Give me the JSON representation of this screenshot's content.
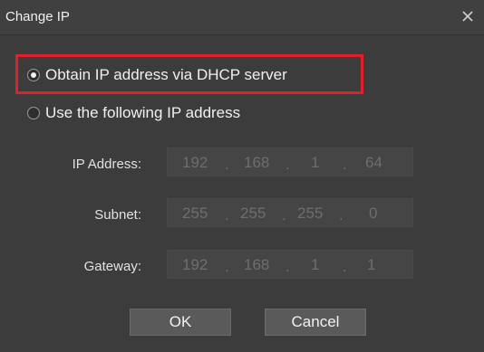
{
  "window": {
    "title": "Change IP"
  },
  "options": {
    "dhcp_label": "Obtain IP address via DHCP server",
    "static_label": "Use the following IP address",
    "selected": "dhcp"
  },
  "fields": {
    "ip": {
      "label": "IP Address:",
      "octets": [
        "192",
        "168",
        "1",
        "64"
      ]
    },
    "subnet": {
      "label": "Subnet:",
      "octets": [
        "255",
        "255",
        "255",
        "0"
      ]
    },
    "gateway": {
      "label": "Gateway:",
      "octets": [
        "192",
        "168",
        "1",
        "1"
      ]
    }
  },
  "buttons": {
    "ok": "OK",
    "cancel": "Cancel"
  },
  "colors": {
    "highlight": "#e0202a",
    "background": "#3c3c3c"
  },
  "icons": {
    "close": "close-icon"
  }
}
